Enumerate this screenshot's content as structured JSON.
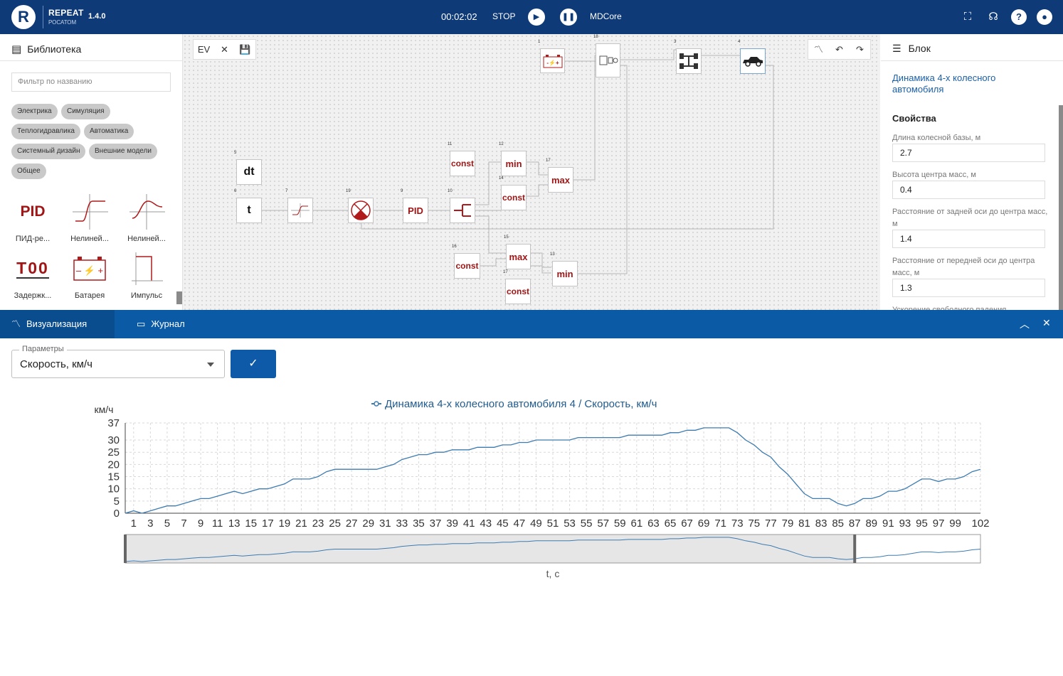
{
  "app": {
    "name": "REPEAT",
    "sub": "РОСАТОМ",
    "version": "1.4.0",
    "logo": "R"
  },
  "sim": {
    "time": "00:02:02",
    "stop": "STOP",
    "engine": "MDCore"
  },
  "library": {
    "title": "Библиотека",
    "filter_placeholder": "Фильтр по названию",
    "tags": [
      "Электрика",
      "Симуляция",
      "Теплогидравлика",
      "Автоматика",
      "Системный дизайн",
      "Внешние модели",
      "Общее"
    ],
    "items": [
      {
        "label": "ПИД-ре...",
        "icon": "pid-icon"
      },
      {
        "label": "Нелиней...",
        "icon": "nonlinear-icon"
      },
      {
        "label": "Нелиней...",
        "icon": "nonlinear-icon"
      },
      {
        "label": "Задержк...",
        "icon": "delay-icon"
      },
      {
        "label": "Батарея",
        "icon": "battery-icon"
      },
      {
        "label": "Импульс",
        "icon": "pulse-icon"
      }
    ]
  },
  "canvas": {
    "ev_label": "EV",
    "blocks": [
      {
        "id": "5",
        "text": "dt"
      },
      {
        "id": "6",
        "text": "t"
      },
      {
        "id": "7",
        "text": ""
      },
      {
        "id": "19",
        "text": ""
      },
      {
        "id": "9",
        "text": "PID"
      },
      {
        "id": "10",
        "text": ""
      },
      {
        "id": "11",
        "text": "const"
      },
      {
        "id": "12",
        "text": "min"
      },
      {
        "id": "14",
        "text": "const"
      },
      {
        "id": "17",
        "text": "max"
      },
      {
        "id": "15",
        "text": "max"
      },
      {
        "id": "16",
        "text": "const"
      },
      {
        "id": "17",
        "text": "const"
      },
      {
        "id": "13",
        "text": "min"
      },
      {
        "id": "1",
        "text": ""
      },
      {
        "id": "18",
        "text": ""
      },
      {
        "id": "3",
        "text": ""
      },
      {
        "id": "4",
        "text": ""
      }
    ]
  },
  "props": {
    "title": "Блок",
    "block_name": "Динамика 4-х колесного автомобиля",
    "section": "Свойства",
    "fields": [
      {
        "label": "Длина колесной базы, м",
        "value": "2.7"
      },
      {
        "label": "Высота центра масс, м",
        "value": "0.4"
      },
      {
        "label": "Расстояние от задней оси до центра масс, м",
        "value": "1.4"
      },
      {
        "label": "Расстояние от передней оси до центра масс, м",
        "value": "1.3"
      }
    ],
    "cut_label": "Ускорение свободного падения"
  },
  "bottom": {
    "tabs": [
      "Визуализация",
      "Журнал"
    ],
    "param_legend": "Параметры",
    "param_value": "Скорость, км/ч"
  },
  "chart_data": {
    "type": "line",
    "title": "Динамика 4-х колесного автомобиля 4 / Скорость, км/ч",
    "ylabel": "км/ч",
    "xlabel": "t, с",
    "ylim": [
      0,
      37
    ],
    "y_ticks": [
      0,
      5,
      10,
      15,
      20,
      25,
      30,
      37
    ],
    "x_ticks": [
      "1",
      "3",
      "5",
      "7",
      "9",
      "11",
      "13",
      "15",
      "17",
      "19",
      "21",
      "23",
      "25",
      "27",
      "29",
      "31",
      "33",
      "35",
      "37",
      "39",
      "41",
      "43",
      "45",
      "47",
      "49",
      "51",
      "53",
      "55",
      "57",
      "59",
      "61",
      "63",
      "65",
      "67",
      "69",
      "71",
      "73",
      "75",
      "77",
      "79",
      "81",
      "83",
      "85",
      "87",
      "89",
      "91",
      "93",
      "95",
      "97",
      "99",
      "102"
    ],
    "series": [
      {
        "name": "Динамика 4-х колесного автомобиля 4 / Скорость, км/ч",
        "color": "#3d7bb0",
        "x": [
          0,
          1,
          2,
          3,
          4,
          5,
          6,
          7,
          8,
          9,
          10,
          11,
          12,
          13,
          14,
          15,
          16,
          17,
          18,
          19,
          20,
          21,
          22,
          23,
          24,
          25,
          26,
          27,
          28,
          29,
          30,
          31,
          32,
          33,
          34,
          35,
          36,
          37,
          38,
          39,
          40,
          41,
          42,
          43,
          44,
          45,
          46,
          47,
          48,
          49,
          50,
          51,
          52,
          53,
          54,
          55,
          56,
          57,
          58,
          59,
          60,
          61,
          62,
          63,
          64,
          65,
          66,
          67,
          68,
          69,
          70,
          71,
          72,
          73,
          74,
          75,
          76,
          77,
          78,
          79,
          80,
          81,
          82,
          83,
          84,
          85,
          86,
          87,
          88,
          89,
          90,
          91,
          92,
          93,
          94,
          95,
          96,
          97,
          98,
          99,
          100,
          101,
          102
        ],
        "values": [
          0,
          1,
          0,
          1,
          2,
          3,
          3,
          4,
          5,
          6,
          6,
          7,
          8,
          9,
          8,
          9,
          10,
          10,
          11,
          12,
          14,
          14,
          14,
          15,
          17,
          18,
          18,
          18,
          18,
          18,
          18,
          19,
          20,
          22,
          23,
          24,
          24,
          25,
          25,
          26,
          26,
          26,
          27,
          27,
          27,
          28,
          28,
          29,
          29,
          30,
          30,
          30,
          30,
          30,
          31,
          31,
          31,
          31,
          31,
          31,
          32,
          32,
          32,
          32,
          32,
          33,
          33,
          34,
          34,
          35,
          35,
          35,
          35,
          33,
          30,
          28,
          25,
          23,
          19,
          16,
          12,
          8,
          6,
          6,
          6,
          4,
          3,
          4,
          6,
          6,
          7,
          9,
          9,
          10,
          12,
          14,
          14,
          13,
          14,
          14,
          15,
          17,
          18
        ]
      }
    ],
    "brush": {
      "start": 0,
      "end": 87
    }
  }
}
